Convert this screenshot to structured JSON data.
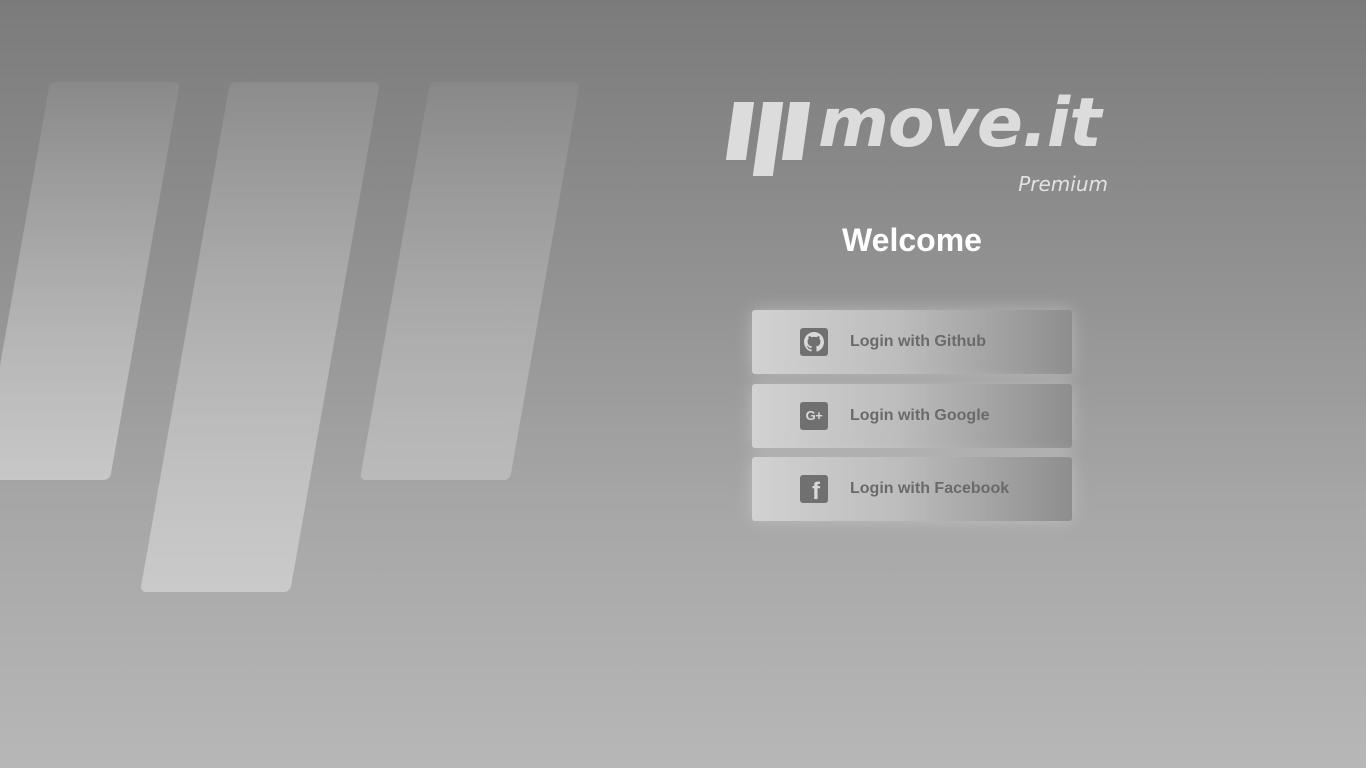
{
  "brand": {
    "name": "move.it",
    "tier": "Premium"
  },
  "welcome": {
    "title": "Welcome"
  },
  "login": {
    "buttons": [
      {
        "label": "Login with Github",
        "icon": "github-icon"
      },
      {
        "label": "Login with Google",
        "icon": "google-plus-icon"
      },
      {
        "label": "Login with Facebook",
        "icon": "facebook-icon"
      }
    ]
  },
  "colors": {
    "background_top": "#7b7b7b",
    "background_bottom": "#b7b7b7",
    "logo": "#dcdcdc",
    "welcome_text": "#ffffff",
    "button_text": "#6a6a6a",
    "icon_bg": "#707070"
  }
}
